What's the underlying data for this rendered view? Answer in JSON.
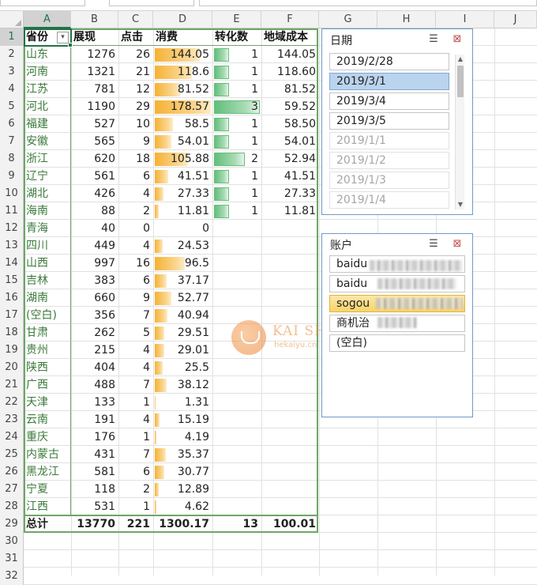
{
  "columns": [
    "A",
    "B",
    "C",
    "D",
    "E",
    "F",
    "G",
    "H",
    "I",
    "J"
  ],
  "row_numbers": [
    "1",
    "2",
    "3",
    "4",
    "5",
    "6",
    "7",
    "8",
    "9",
    "10",
    "11",
    "12",
    "13",
    "14",
    "15",
    "16",
    "17",
    "18",
    "19",
    "20",
    "21",
    "22",
    "23",
    "24",
    "25",
    "26",
    "27",
    "28",
    "29",
    "30",
    "31",
    "32"
  ],
  "header": {
    "province": "省份",
    "impressions": "展现",
    "clicks": "点击",
    "spend": "消费",
    "conversions": "转化数",
    "region_cost": "地域成本"
  },
  "rows": [
    {
      "province": "山东",
      "impressions": "1276",
      "clicks": "26",
      "spend": "144.05",
      "conversions": "1",
      "region_cost": "144.05"
    },
    {
      "province": "河南",
      "impressions": "1321",
      "clicks": "21",
      "spend": "118.6",
      "conversions": "1",
      "region_cost": "118.60"
    },
    {
      "province": "江苏",
      "impressions": "781",
      "clicks": "12",
      "spend": "81.52",
      "conversions": "1",
      "region_cost": "81.52"
    },
    {
      "province": "河北",
      "impressions": "1190",
      "clicks": "29",
      "spend": "178.57",
      "conversions": "3",
      "region_cost": "59.52"
    },
    {
      "province": "福建",
      "impressions": "527",
      "clicks": "10",
      "spend": "58.5",
      "conversions": "1",
      "region_cost": "58.50"
    },
    {
      "province": "安徽",
      "impressions": "565",
      "clicks": "9",
      "spend": "54.01",
      "conversions": "1",
      "region_cost": "54.01"
    },
    {
      "province": "浙江",
      "impressions": "620",
      "clicks": "18",
      "spend": "105.88",
      "conversions": "2",
      "region_cost": "52.94"
    },
    {
      "province": "辽宁",
      "impressions": "561",
      "clicks": "6",
      "spend": "41.51",
      "conversions": "1",
      "region_cost": "41.51"
    },
    {
      "province": "湖北",
      "impressions": "426",
      "clicks": "4",
      "spend": "27.33",
      "conversions": "1",
      "region_cost": "27.33"
    },
    {
      "province": "海南",
      "impressions": "88",
      "clicks": "2",
      "spend": "11.81",
      "conversions": "1",
      "region_cost": "11.81"
    },
    {
      "province": "青海",
      "impressions": "40",
      "clicks": "0",
      "spend": "0",
      "conversions": "",
      "region_cost": ""
    },
    {
      "province": "四川",
      "impressions": "449",
      "clicks": "4",
      "spend": "24.53",
      "conversions": "",
      "region_cost": ""
    },
    {
      "province": "山西",
      "impressions": "997",
      "clicks": "16",
      "spend": "96.5",
      "conversions": "",
      "region_cost": ""
    },
    {
      "province": "吉林",
      "impressions": "383",
      "clicks": "6",
      "spend": "37.17",
      "conversions": "",
      "region_cost": ""
    },
    {
      "province": "湖南",
      "impressions": "660",
      "clicks": "9",
      "spend": "52.77",
      "conversions": "",
      "region_cost": ""
    },
    {
      "province": "(空白)",
      "impressions": "356",
      "clicks": "7",
      "spend": "40.94",
      "conversions": "",
      "region_cost": ""
    },
    {
      "province": "甘肃",
      "impressions": "262",
      "clicks": "5",
      "spend": "29.51",
      "conversions": "",
      "region_cost": ""
    },
    {
      "province": "贵州",
      "impressions": "215",
      "clicks": "4",
      "spend": "29.01",
      "conversions": "",
      "region_cost": ""
    },
    {
      "province": "陕西",
      "impressions": "404",
      "clicks": "4",
      "spend": "25.5",
      "conversions": "",
      "region_cost": ""
    },
    {
      "province": "广西",
      "impressions": "488",
      "clicks": "7",
      "spend": "38.12",
      "conversions": "",
      "region_cost": ""
    },
    {
      "province": "天津",
      "impressions": "133",
      "clicks": "1",
      "spend": "1.31",
      "conversions": "",
      "region_cost": ""
    },
    {
      "province": "云南",
      "impressions": "191",
      "clicks": "4",
      "spend": "15.19",
      "conversions": "",
      "region_cost": ""
    },
    {
      "province": "重庆",
      "impressions": "176",
      "clicks": "1",
      "spend": "4.19",
      "conversions": "",
      "region_cost": ""
    },
    {
      "province": "内蒙古",
      "impressions": "431",
      "clicks": "7",
      "spend": "35.37",
      "conversions": "",
      "region_cost": ""
    },
    {
      "province": "黑龙江",
      "impressions": "581",
      "clicks": "6",
      "spend": "30.77",
      "conversions": "",
      "region_cost": ""
    },
    {
      "province": "宁夏",
      "impressions": "118",
      "clicks": "2",
      "spend": "12.89",
      "conversions": "",
      "region_cost": ""
    },
    {
      "province": "江西",
      "impressions": "531",
      "clicks": "1",
      "spend": "4.62",
      "conversions": "",
      "region_cost": ""
    }
  ],
  "spend_values": [
    144.05,
    118.6,
    81.52,
    178.57,
    58.5,
    54.01,
    105.88,
    41.51,
    27.33,
    11.81,
    0,
    24.53,
    96.5,
    37.17,
    52.77,
    40.94,
    29.51,
    29.01,
    25.5,
    38.12,
    1.31,
    15.19,
    4.19,
    35.37,
    30.77,
    12.89,
    4.62
  ],
  "conversion_values": [
    1,
    1,
    1,
    3,
    1,
    1,
    2,
    1,
    1,
    1
  ],
  "total": {
    "label": "总计",
    "impressions": "13770",
    "clicks": "221",
    "spend": "1300.17",
    "conversions": "13",
    "region_cost": "100.01"
  },
  "slicer_date": {
    "title": "日期",
    "items": [
      {
        "label": "2019/2/28",
        "state": "normal"
      },
      {
        "label": "2019/3/1",
        "state": "selected"
      },
      {
        "label": "2019/3/4",
        "state": "normal"
      },
      {
        "label": "2019/3/5",
        "state": "normal"
      },
      {
        "label": "2019/1/1",
        "state": "nodata"
      },
      {
        "label": "2019/1/2",
        "state": "nodata"
      },
      {
        "label": "2019/1/3",
        "state": "nodata"
      },
      {
        "label": "2019/1/4",
        "state": "nodata"
      }
    ]
  },
  "slicer_account": {
    "title": "账户",
    "items": [
      {
        "label": "baidu",
        "state": "normal"
      },
      {
        "label": "baidu",
        "state": "normal"
      },
      {
        "label": "sogou",
        "state": "highlight"
      },
      {
        "label": "商机治",
        "state": "normal"
      },
      {
        "label": "(空白)",
        "state": "normal"
      }
    ]
  },
  "watermark": {
    "text": "KAI SHU",
    "sub": "hekaiyu.cn"
  },
  "colors": {
    "databar_gold": "#f5b233",
    "databar_green": "#63be7b",
    "pivot_border": "#6ea766",
    "slicer_border": "#6f9ac7"
  }
}
